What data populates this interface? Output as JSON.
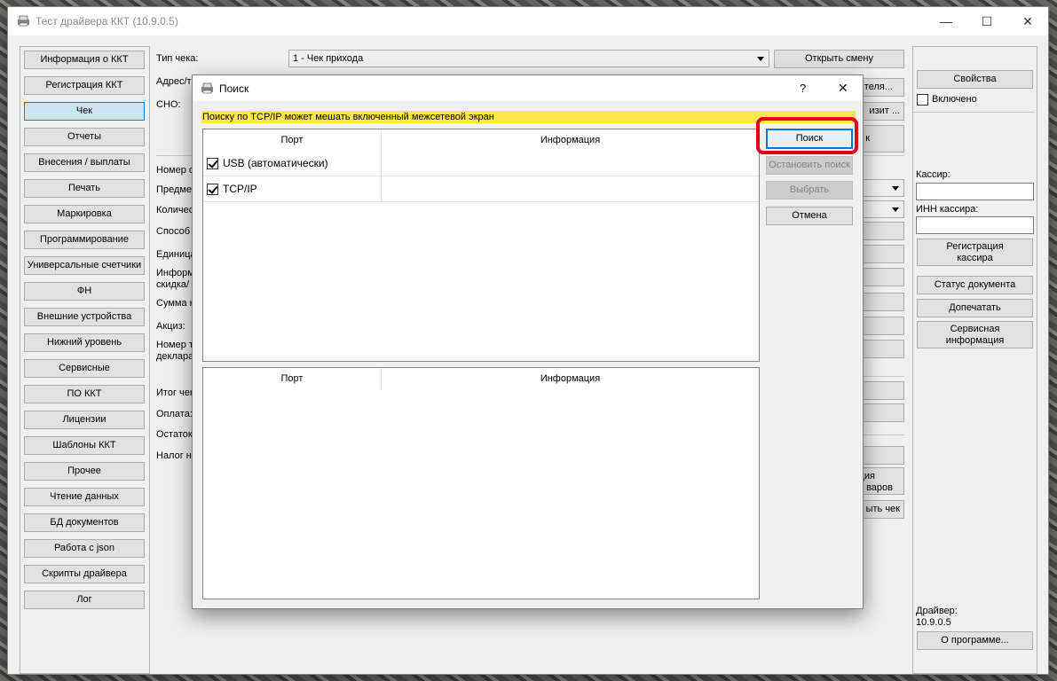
{
  "window": {
    "title": "Тест драйвера ККТ (10.9.0.5)",
    "minimize": "—",
    "maximize": "☐",
    "close": "✕"
  },
  "sidebar": {
    "items": [
      {
        "label": "Информация о ККТ"
      },
      {
        "label": "Регистрация ККТ"
      },
      {
        "label": "Чек",
        "selected": true
      },
      {
        "label": "Отчеты"
      },
      {
        "label": "Внесения / выплаты"
      },
      {
        "label": "Печать"
      },
      {
        "label": "Маркировка"
      },
      {
        "label": "Программирование"
      },
      {
        "label": "Универсальные счетчики"
      },
      {
        "label": "ФН"
      },
      {
        "label": "Внешние устройства"
      },
      {
        "label": "Нижний уровень"
      },
      {
        "label": "Сервисные"
      },
      {
        "label": "ПО ККТ"
      },
      {
        "label": "Лицензии"
      },
      {
        "label": "Шаблоны ККТ"
      },
      {
        "label": "Прочее"
      },
      {
        "label": "Чтение данных"
      },
      {
        "label": "БД документов"
      },
      {
        "label": "Работа с json"
      },
      {
        "label": "Скрипты драйвера"
      },
      {
        "label": "Лог"
      }
    ]
  },
  "center": {
    "receipt_type_label": "Тип чека:",
    "receipt_type_value": "1 - Чек прихода",
    "address_label": "Адрес/т",
    "sno_label": "СНО:",
    "labels_partial": [
      "Номер о",
      "Предмет",
      "Количес",
      "Способ р",
      "Единица",
      "Информ",
      "скидка/",
      "Сумма н",
      "Акциз:",
      "Номер т",
      "деклара",
      "Итог чек",
      "Оплата:",
      "Остаток",
      "Налог н"
    ],
    "right_buttons": {
      "open_shift": "Открыть смену",
      "b2": "теля...",
      "b3": "изит ...",
      "b4": "к",
      "b5": "ция",
      "b6": "варов",
      "b7": "ыть чек"
    }
  },
  "right_panel": {
    "properties": "Свойства",
    "enabled_label": "Включено",
    "cashier_label": "Кассир:",
    "cashier_inn_label": "ИНН кассира:",
    "register_cashier": "Регистрация кассира",
    "doc_status": "Статус документа",
    "reprint": "Допечатать",
    "service_info": "Сервисная информация",
    "driver_label": "Драйвер:",
    "driver_version": "10.9.0.5",
    "about": "О программе..."
  },
  "dialog": {
    "title": "Поиск",
    "help": "?",
    "close": "✕",
    "warning": "Поиску по TCP/IP может мешать включенный межсетевой экран",
    "grid_top": {
      "headers": {
        "port": "Порт",
        "info": "Информация"
      },
      "rows": [
        {
          "label": "USB (автоматически)",
          "checked": true
        },
        {
          "label": "TCP/IP",
          "checked": true
        }
      ]
    },
    "grid_bottom": {
      "headers": {
        "port": "Порт",
        "info": "Информация"
      }
    },
    "buttons": {
      "search": "Поиск",
      "stop_search": "Остановить поиск",
      "select": "Выбрать",
      "cancel": "Отмена"
    }
  }
}
